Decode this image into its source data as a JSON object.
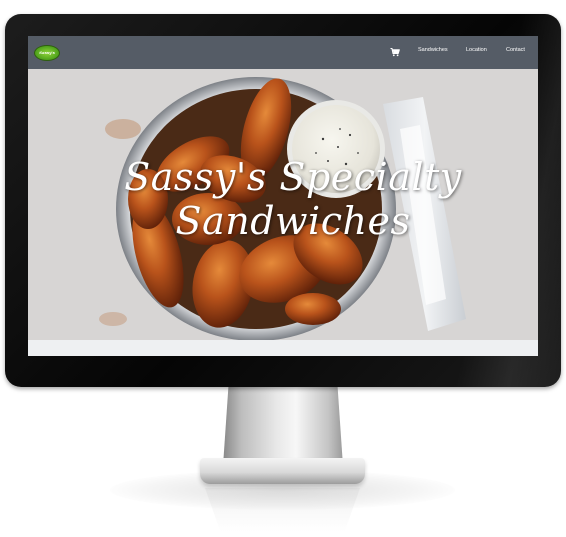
{
  "site": {
    "logo_alt": "Sassy's",
    "nav": {
      "cart_icon": "shopping-cart-icon",
      "links": [
        "Sandwiches",
        "Location",
        "Contact"
      ]
    },
    "hero": {
      "title_line1": "Sassy's  Specialty",
      "title_line2": "Sandwiches"
    }
  },
  "colors": {
    "nav_background": "#555c66",
    "bezel": "#0b0b0b",
    "logo_green": "#4ea11b"
  }
}
